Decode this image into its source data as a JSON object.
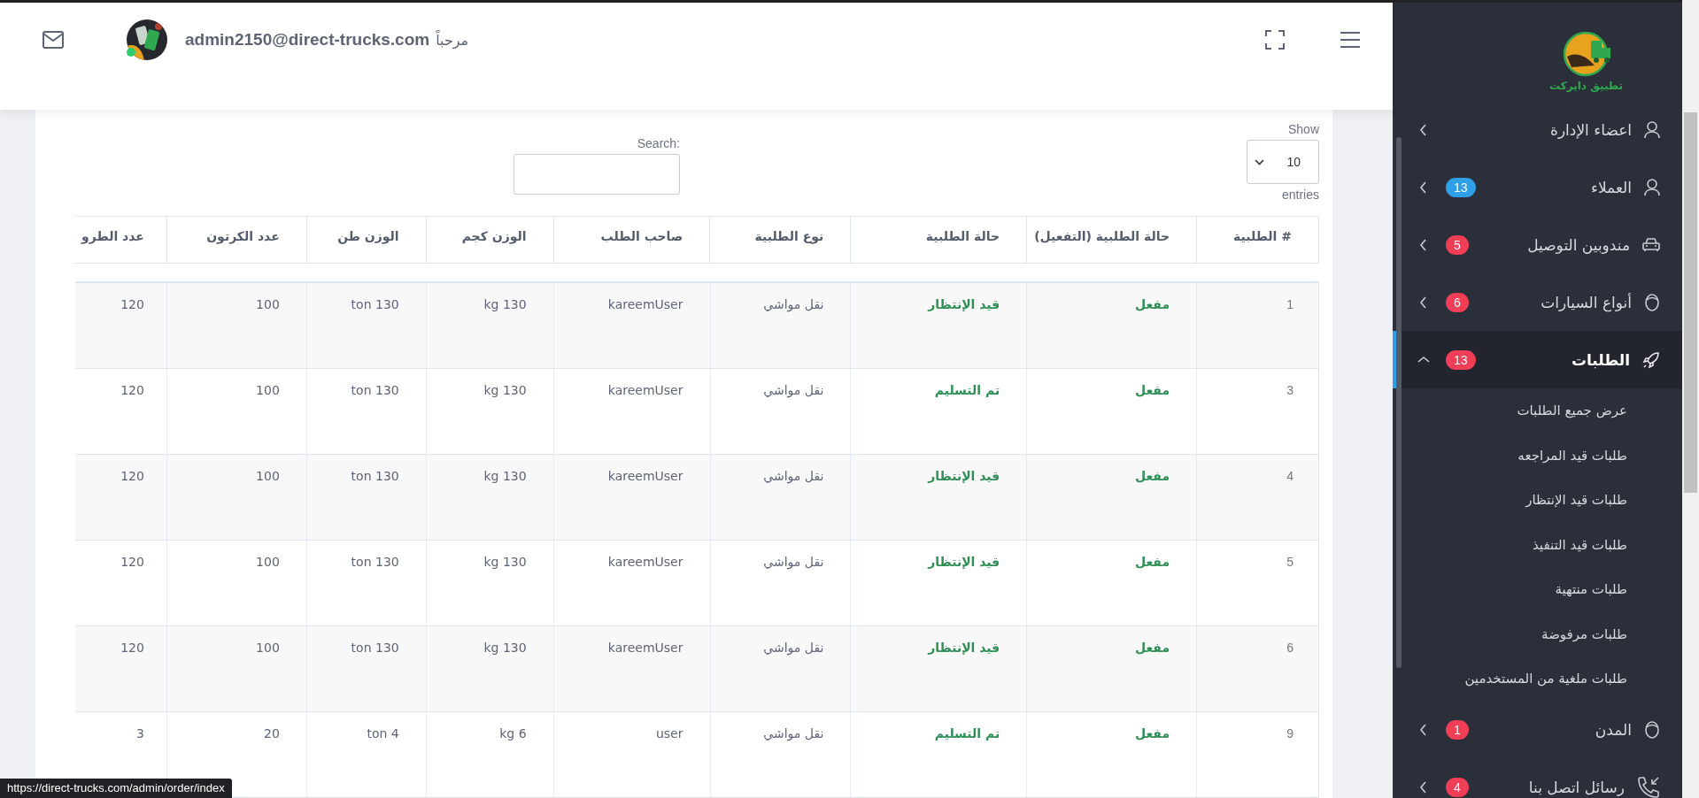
{
  "header": {
    "user_email": "admin2150@direct-trucks.com",
    "greeting": "مرحباً",
    "online": true
  },
  "sidebar": {
    "logo_text": "تطبيق دايركت",
    "items": [
      {
        "label": "اعضاء الإدارة",
        "kind": "user",
        "selected": false,
        "expanded": false
      },
      {
        "label": "العملاء",
        "kind": "user",
        "badge": "13",
        "color": "#2f9fe8",
        "selected": false,
        "expanded": false
      },
      {
        "label": "مندوبين التوصيل",
        "kind": "car",
        "badge": "5",
        "color": "#ef3e56",
        "selected": false,
        "expanded": false
      },
      {
        "label": "أنواع السيارات",
        "kind": "face",
        "badge": "6",
        "color": "#ef3e56",
        "selected": false,
        "expanded": false
      },
      {
        "label": "الطلبات",
        "kind": "rocket",
        "badge": "13",
        "color": "#ef3e56",
        "selected": true,
        "expanded": true,
        "children": [
          {
            "label": "عرض جميع الطلبات"
          },
          {
            "label": "طلبات قيد المراجعه"
          },
          {
            "label": "طلبات قيد الإنتظار"
          },
          {
            "label": "طلبات قيد التنفيذ"
          },
          {
            "label": "طلبات منتهية"
          },
          {
            "label": "طلبات مرفوضة"
          },
          {
            "label": "طلبات ملغية من المستخدمين"
          }
        ]
      },
      {
        "label": "المدن",
        "kind": "face",
        "badge": "1",
        "color": "#ef3e56",
        "selected": false,
        "expanded": false
      },
      {
        "label": "رسائل اتصل بنا",
        "kind": "phone",
        "badge": "4",
        "color": "#ef3e56",
        "selected": false,
        "expanded": false
      }
    ]
  },
  "table_controls": {
    "show_label": "Show",
    "page_size": "10",
    "entries_label": "entries",
    "search_label": "Search:"
  },
  "table": {
    "columns": [
      "# الطلبية",
      "حالة الطلبية (التفعيل)",
      "حالة الطلبية",
      "نوع الطلبية",
      "صاحب الطلب",
      "الوزن كجم",
      "الوزن طن",
      "عدد الكرتون",
      "عدد الطرو"
    ],
    "rows": [
      [
        "1",
        "مفعل",
        "قيد الإنتظار",
        "نقل مواشي",
        "kareemUser",
        "kg 130",
        "ton 130",
        "100",
        "120"
      ],
      [
        "3",
        "مفعل",
        "تم التسليم",
        "نقل مواشي",
        "kareemUser",
        "kg 130",
        "ton 130",
        "100",
        "120"
      ],
      [
        "4",
        "مفعل",
        "قيد الإنتظار",
        "نقل مواشي",
        "kareemUser",
        "kg 130",
        "ton 130",
        "100",
        "120"
      ],
      [
        "5",
        "مفعل",
        "قيد الإنتظار",
        "نقل مواشي",
        "kareemUser",
        "kg 130",
        "ton 130",
        "100",
        "120"
      ],
      [
        "6",
        "مفعل",
        "قيد الإنتظار",
        "نقل مواشي",
        "kareemUser",
        "kg 130",
        "ton 130",
        "100",
        "120"
      ],
      [
        "9",
        "مفعل",
        "تم التسليم",
        "نقل مواشي",
        "user",
        "kg 6",
        "ton 4",
        "20",
        "3"
      ]
    ]
  },
  "status_bar": {
    "url": "https://direct-trucks.com/admin/order/index"
  }
}
